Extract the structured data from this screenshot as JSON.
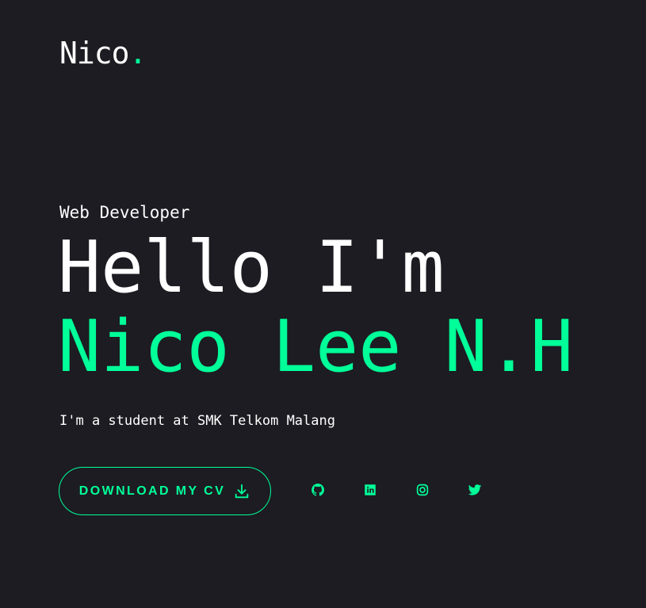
{
  "brand": {
    "name": "Nico",
    "dot": "."
  },
  "hero": {
    "role": "Web Developer",
    "greeting": "Hello I'm",
    "name": "Nico Lee N.H",
    "bio": "I'm a student at SMK Telkom Malang"
  },
  "cta": {
    "label": "Download my CV",
    "icon": "download-icon"
  },
  "socials": [
    {
      "name": "github",
      "icon": "github-icon"
    },
    {
      "name": "linkedin",
      "icon": "linkedin-icon"
    },
    {
      "name": "instagram",
      "icon": "instagram-icon"
    },
    {
      "name": "twitter",
      "icon": "twitter-icon"
    }
  ],
  "colors": {
    "background": "#1c1c22",
    "accent": "#00ff99",
    "text": "#ffffff"
  }
}
